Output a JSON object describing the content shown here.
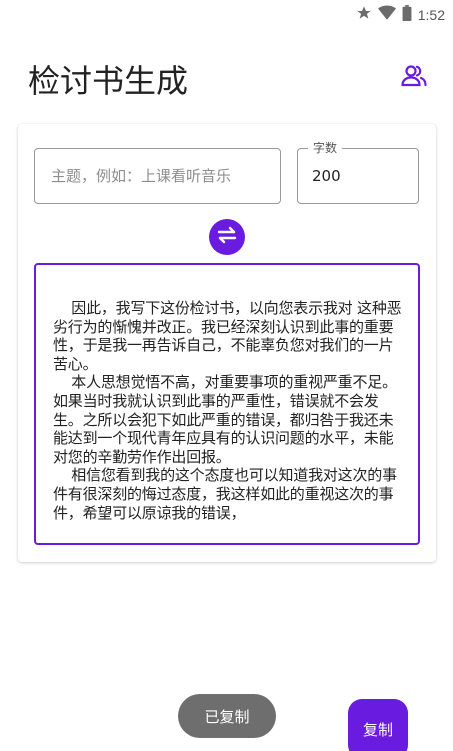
{
  "status_bar": {
    "time": "1:52",
    "icons": [
      "star-icon",
      "wifi-icon",
      "battery-icon"
    ]
  },
  "app": {
    "title": "检讨书生成",
    "users_icon": "users-icon"
  },
  "form": {
    "topic_placeholder": "主题，例如：上课看听音乐",
    "topic_value": "",
    "word_count_label": "字数",
    "word_count_value": "200",
    "swap_icon": "swap-icon"
  },
  "result": {
    "text": "    因此，我写下这份检讨书，以向您表示我对 这种恶劣行为的惭愧并改正。我已经深刻认识到此事的重要性，于是我一再告诉自己，不能辜负您对我们的一片苦心。\n    本人思想觉悟不高，对重要事项的重视严重不足。如果当时我就认识到此事的严重性，错误就不会发生。之所以会犯下如此严重的错误，都归咎于我还未能达到一个现代青年应具有的认识问题的水平，未能对您的辛勤劳作作出回报。\n    相信您看到我的这个态度也可以知道我对这次的事件有很深刻的悔过态度，我这样如此的重视这次的事件，希望可以原谅我的错误，"
  },
  "toast": {
    "text": "已复制"
  },
  "actions": {
    "copy_label": "复制"
  },
  "colors": {
    "accent": "#6a1be0",
    "toast_bg": "#6e6e6e"
  }
}
